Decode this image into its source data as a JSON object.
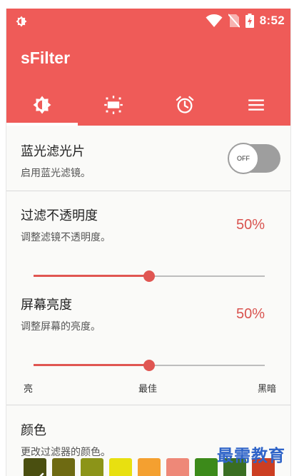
{
  "status_bar": {
    "time": "8:52",
    "left_icon": "brightness-icon",
    "right_icons": [
      "wifi-icon",
      "no-sim-icon",
      "battery-charging-icon"
    ]
  },
  "app": {
    "title": "sFilter",
    "accent_color": "#ef5b58",
    "tabs": [
      {
        "icon": "brightness-icon",
        "active": true
      },
      {
        "icon": "filter-intensity-icon",
        "active": false
      },
      {
        "icon": "alarm-clock-icon",
        "active": false
      },
      {
        "icon": "menu-icon",
        "active": false
      }
    ]
  },
  "blue_filter": {
    "title": "蓝光滤光片",
    "subtitle": "启用蓝光滤镜。",
    "toggle_label": "OFF",
    "enabled": false
  },
  "opacity": {
    "title": "过滤不透明度",
    "subtitle": "调整滤镜不透明度。",
    "value_text": "50%",
    "value": 50
  },
  "brightness": {
    "title": "屏幕亮度",
    "subtitle": "调整屏幕的亮度。",
    "value_text": "50%",
    "value": 50,
    "scale_labels": [
      "亮",
      "最佳",
      "黑暗"
    ]
  },
  "color": {
    "title": "颜色",
    "subtitle": "更改过滤器的颜色。",
    "swatches": [
      "#4a4f10",
      "#6e6a12",
      "#8c9418",
      "#e8e010",
      "#f4a030",
      "#ee8878",
      "#3c8a1a",
      "#3a6e22",
      "#cc3e22"
    ],
    "selected_index": 0
  },
  "watermark": "最需教育"
}
